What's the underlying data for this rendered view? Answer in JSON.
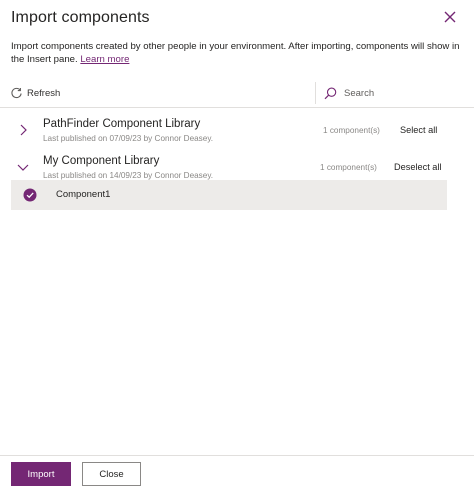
{
  "dialog": {
    "title": "Import components",
    "description": "Import components created by other people in your environment. After importing, components will show in the Insert pane.",
    "learn_more": "Learn more"
  },
  "toolbar": {
    "refresh_label": "Refresh",
    "search_placeholder": "Search"
  },
  "libraries": [
    {
      "name": "PathFinder Component Library",
      "meta": "Last published on 07/09/23 by Connor Deasey.",
      "count": "1 component(s)",
      "action": "Select all",
      "expanded": false
    },
    {
      "name": "My Component Library",
      "meta": "Last published on 14/09/23 by Connor Deasey.",
      "count": "1 component(s)",
      "action": "Deselect all",
      "expanded": true,
      "components": [
        {
          "name": "Component1",
          "selected": true
        }
      ]
    }
  ],
  "footer": {
    "import_label": "Import",
    "close_label": "Close"
  },
  "colors": {
    "accent": "#742774",
    "selected_row_bg": "#edebe9",
    "muted_text": "#8a8886"
  },
  "icons": [
    "close-icon",
    "refresh-icon",
    "search-icon",
    "chevron-right-icon",
    "chevron-down-icon",
    "checkmark-circle-icon"
  ]
}
